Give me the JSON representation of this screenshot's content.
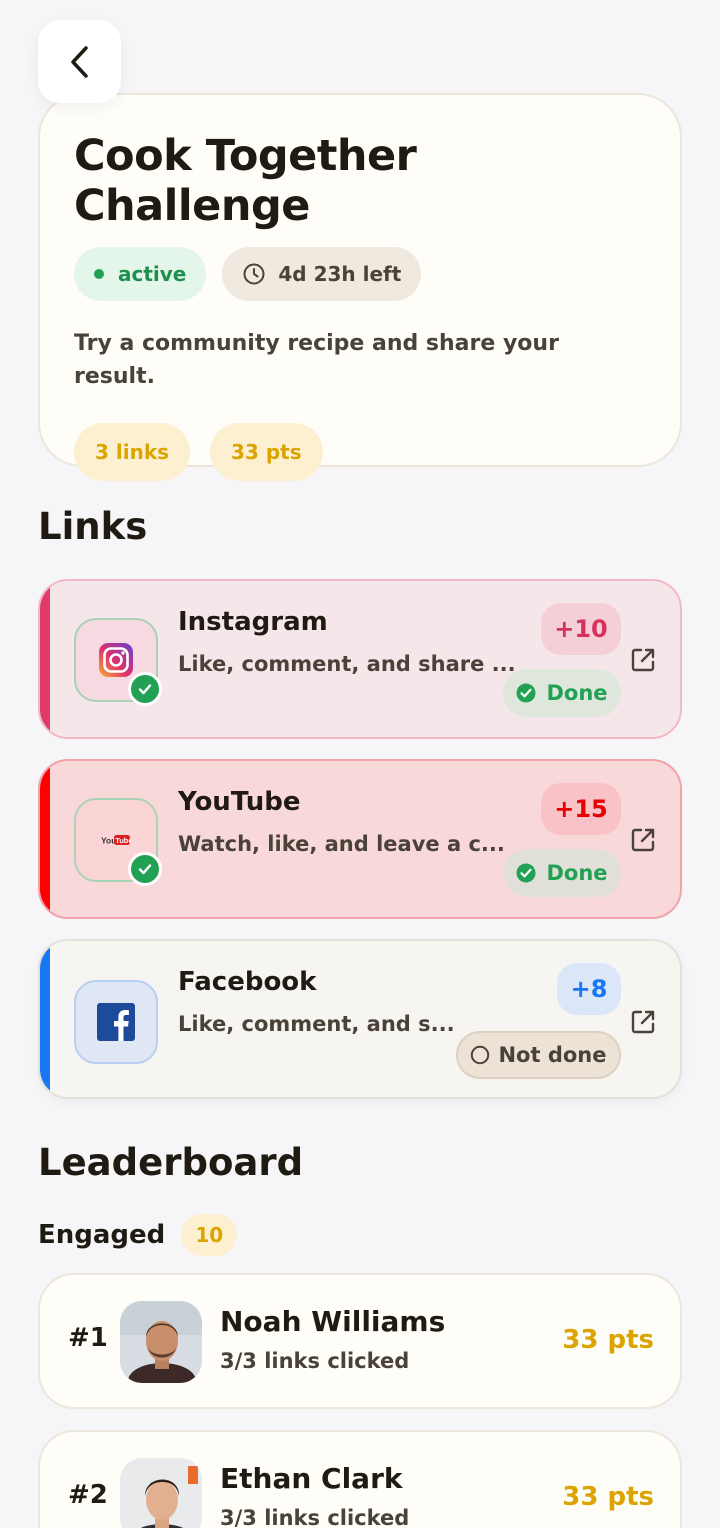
{
  "header": {
    "back_icon": "chevron-left-icon"
  },
  "challenge": {
    "title": "Cook Together Challenge",
    "status": "active",
    "time_left": "4d 23h left",
    "description": "Try a community recipe and share your result.",
    "links_count": "3 links",
    "points": "33 pts"
  },
  "links_section": {
    "title": "Links",
    "items": [
      {
        "name": "Instagram",
        "description": "Like, comment, and share ...",
        "points": "+10",
        "status": "Done",
        "brand_color": "#e03a6a"
      },
      {
        "name": "YouTube",
        "description": "Watch, like, and leave a c...",
        "points": "+15",
        "status": "Done",
        "brand_color": "#ff0000"
      },
      {
        "name": "Facebook",
        "description": "Like, comment, and s...",
        "points": "+8",
        "status": "Not done",
        "brand_color": "#1877f2"
      }
    ],
    "youtube_logo_text": {
      "you": "You",
      "tube": "Tube"
    }
  },
  "leaderboard": {
    "title": "Leaderboard",
    "engaged_label": "Engaged",
    "engaged_count": "10",
    "entries": [
      {
        "rank": "#1",
        "name": "Noah Williams",
        "clicks": "3/3 links clicked",
        "points": "33 pts"
      },
      {
        "rank": "#2",
        "name": "Ethan Clark",
        "clicks": "3/3 links clicked",
        "points": "33 pts"
      }
    ]
  },
  "colors": {
    "accent_gold": "#dba400",
    "success_green": "#22a155",
    "background": "#f6f6f8"
  }
}
